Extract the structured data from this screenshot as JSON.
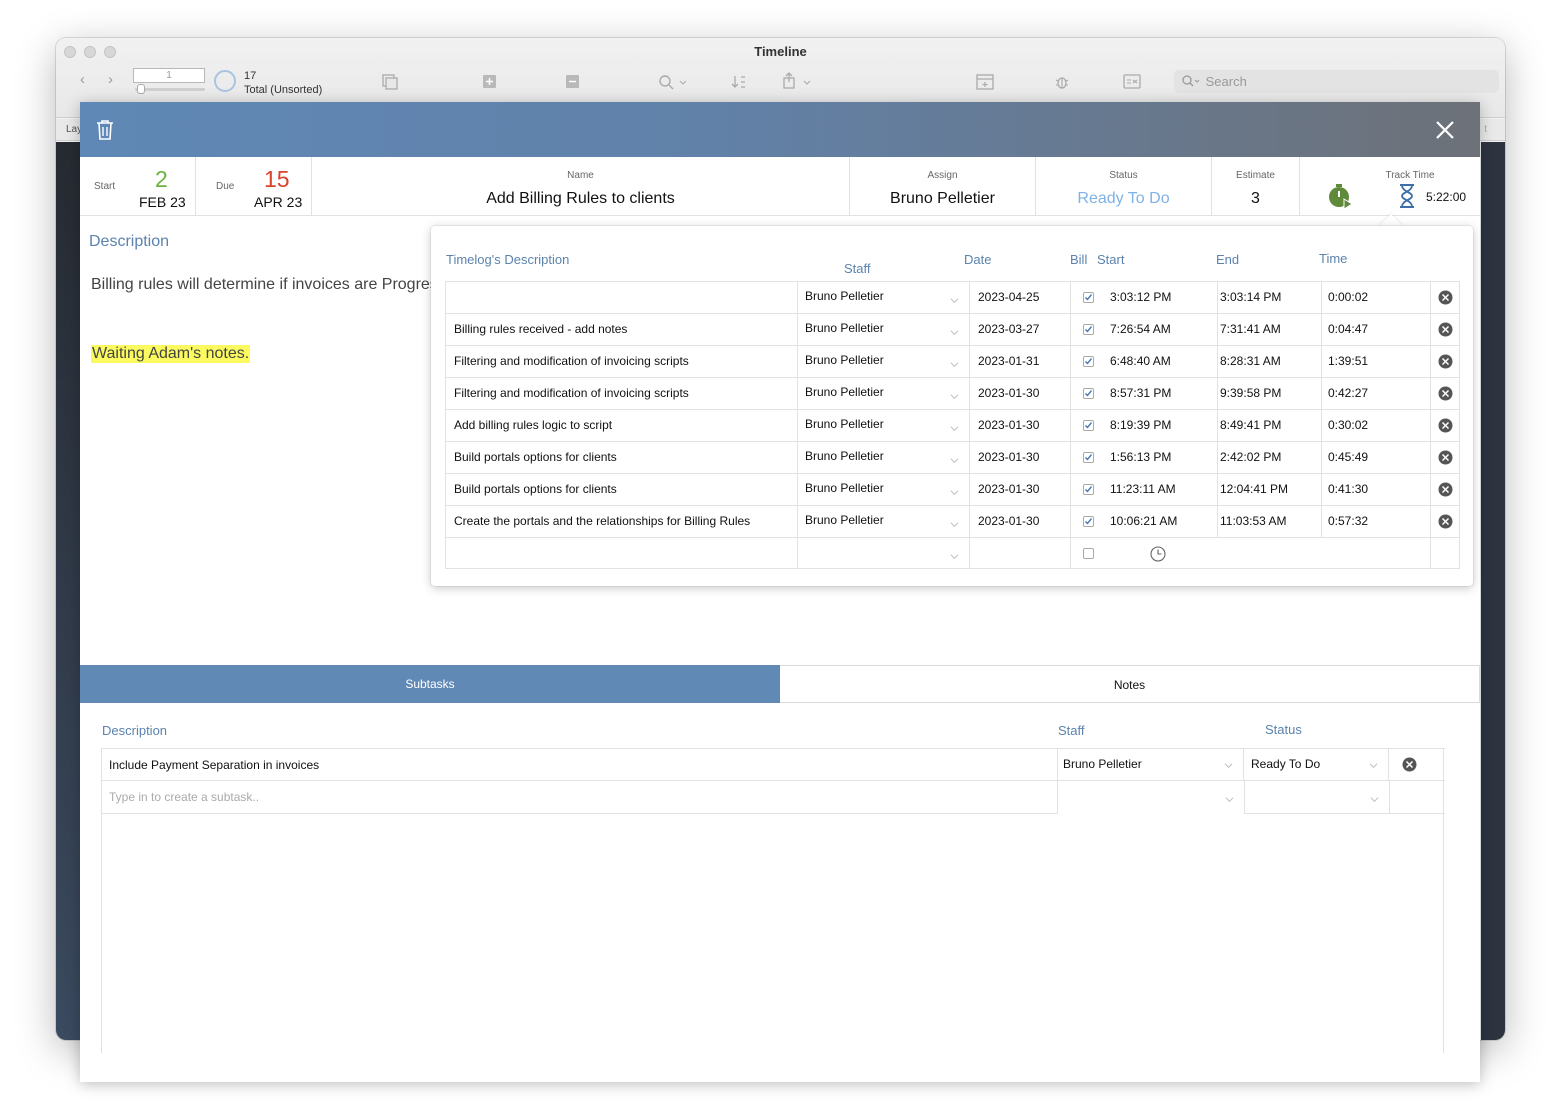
{
  "window": {
    "title": "Timeline",
    "record_number": "1",
    "found_count": "17",
    "found_label": "Total (Unsorted)",
    "search_placeholder": "Search",
    "layout_label": "Lay",
    "layout_right": "t"
  },
  "task": {
    "start_label": "Start",
    "start_day": "2",
    "start_month": "FEB 23",
    "due_label": "Due",
    "due_day": "15",
    "due_month": "APR 23",
    "name_label": "Name",
    "name": "Add Billing Rules to clients",
    "assign_label": "Assign",
    "assign": "Bruno Pelletier",
    "status_label": "Status",
    "status": "Ready To Do",
    "estimate_label": "Estimate",
    "estimate": "3",
    "track_label": "Track Time",
    "track_total": "5:22:00",
    "colors": {
      "start": "#6db33f",
      "due": "#d9432b",
      "status": "#7fb2e5",
      "accent": "#5b83ad"
    }
  },
  "description": {
    "title": "Description",
    "text": "Billing rules will determine if invoices are Progress",
    "note": "Waiting Adam's notes."
  },
  "timelog": {
    "headers": {
      "description": "Timelog's Description",
      "staff": "Staff",
      "date": "Date",
      "bill": "Bill",
      "start": "Start",
      "end": "End",
      "time": "Time"
    },
    "rows": [
      {
        "description": "",
        "staff": "Bruno Pelletier",
        "date": "2023-04-25",
        "bill": true,
        "start": "3:03:12 PM",
        "end": "3:03:14 PM",
        "time": "0:00:02"
      },
      {
        "description": "Billing rules received - add notes",
        "staff": "Bruno Pelletier",
        "date": "2023-03-27",
        "bill": true,
        "start": "7:26:54 AM",
        "end": "7:31:41 AM",
        "time": "0:04:47"
      },
      {
        "description": "Filtering and modification of invoicing scripts",
        "staff": "Bruno Pelletier",
        "date": "2023-01-31",
        "bill": true,
        "start": "6:48:40 AM",
        "end": "8:28:31 AM",
        "time": "1:39:51"
      },
      {
        "description": "Filtering and modification of invoicing scripts",
        "staff": "Bruno Pelletier",
        "date": "2023-01-30",
        "bill": true,
        "start": "8:57:31 PM",
        "end": "9:39:58 PM",
        "time": "0:42:27"
      },
      {
        "description": "Add billing rules logic to script",
        "staff": "Bruno Pelletier",
        "date": "2023-01-30",
        "bill": true,
        "start": "8:19:39 PM",
        "end": "8:49:41 PM",
        "time": "0:30:02"
      },
      {
        "description": "Build portals options for clients",
        "staff": "Bruno Pelletier",
        "date": "2023-01-30",
        "bill": true,
        "start": "1:56:13 PM",
        "end": "2:42:02 PM",
        "time": "0:45:49"
      },
      {
        "description": "Build portals options for clients",
        "staff": "Bruno Pelletier",
        "date": "2023-01-30",
        "bill": true,
        "start": "11:23:11 AM",
        "end": "12:04:41 PM",
        "time": "0:41:30"
      },
      {
        "description": "Create the portals and the relationships for Billing Rules",
        "staff": "Bruno Pelletier",
        "date": "2023-01-30",
        "bill": true,
        "start": "10:06:21 AM",
        "end": "11:03:53 AM",
        "time": "0:57:32"
      }
    ]
  },
  "tabs": {
    "subtasks": "Subtasks",
    "notes": "Notes"
  },
  "subtasks": {
    "headers": {
      "description": "Description",
      "staff": "Staff",
      "status": "Status"
    },
    "rows": [
      {
        "description": "Include Payment Separation in invoices",
        "staff": "Bruno Pelletier",
        "status": "Ready To Do"
      }
    ],
    "new_placeholder": "Type in to create a subtask.."
  }
}
